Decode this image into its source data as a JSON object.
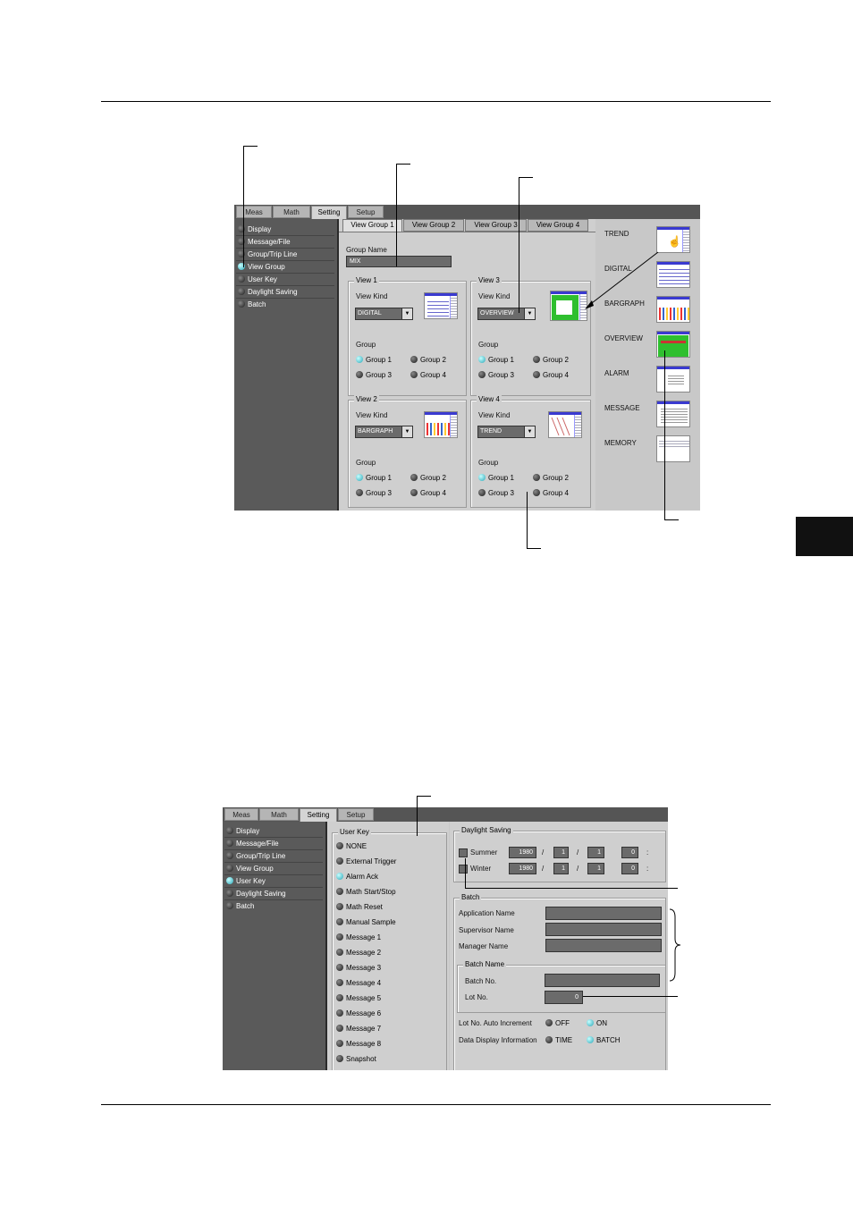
{
  "top_window": {
    "tabs": [
      "Meas",
      "Math",
      "Setting",
      "Setup"
    ],
    "active_tab": "Setting",
    "nav": [
      {
        "label": "Display",
        "active": false
      },
      {
        "label": "Message/File",
        "active": false
      },
      {
        "label": "Group/Trip Line",
        "active": false
      },
      {
        "label": "View Group",
        "active": true
      },
      {
        "label": "User Key",
        "active": false
      },
      {
        "label": "Daylight Saving",
        "active": false
      },
      {
        "label": "Batch",
        "active": false
      }
    ],
    "subtabs": [
      "View Group 1",
      "View Group 2",
      "View Group 3",
      "View Group 4"
    ],
    "group_name_label": "Group Name",
    "group_name_value": "MIX",
    "views": [
      {
        "title": "View 1",
        "kind_label": "View Kind",
        "kind": "DIGITAL",
        "group_label": "Group",
        "groups": [
          "Group 1",
          "Group 2",
          "Group 3",
          "Group 4"
        ],
        "selected": "Group 1"
      },
      {
        "title": "View 3",
        "kind_label": "View Kind",
        "kind": "OVERVIEW",
        "group_label": "Group",
        "groups": [
          "Group 1",
          "Group 2",
          "Group 3",
          "Group 4"
        ],
        "selected": "Group 1"
      },
      {
        "title": "View 2",
        "kind_label": "View Kind",
        "kind": "BARGRAPH",
        "group_label": "Group",
        "groups": [
          "Group 1",
          "Group 2",
          "Group 3",
          "Group 4"
        ],
        "selected": "Group 1"
      },
      {
        "title": "View 4",
        "kind_label": "View Kind",
        "kind": "TREND",
        "group_label": "Group",
        "groups": [
          "Group 1",
          "Group 2",
          "Group 3",
          "Group 4"
        ],
        "selected": "Group 1"
      }
    ],
    "kind_list": [
      "TREND",
      "DIGITAL",
      "BARGRAPH",
      "OVERVIEW",
      "ALARM",
      "MESSAGE",
      "MEMORY"
    ]
  },
  "bottom_window": {
    "tabs": [
      "Meas",
      "Math",
      "Setting",
      "Setup"
    ],
    "active_tab": "Setting",
    "nav": [
      {
        "label": "Display",
        "active": false
      },
      {
        "label": "Message/File",
        "active": false
      },
      {
        "label": "Group/Trip Line",
        "active": false
      },
      {
        "label": "View Group",
        "active": false
      },
      {
        "label": "User Key",
        "active": true
      },
      {
        "label": "Daylight Saving",
        "active": false
      },
      {
        "label": "Batch",
        "active": false
      }
    ],
    "user_key_title": "User Key",
    "user_keys": [
      {
        "label": "NONE",
        "selected": false
      },
      {
        "label": "External Trigger",
        "selected": false
      },
      {
        "label": "Alarm Ack",
        "selected": true
      },
      {
        "label": "Math Start/Stop",
        "selected": false
      },
      {
        "label": "Math Reset",
        "selected": false
      },
      {
        "label": "Manual Sample",
        "selected": false
      },
      {
        "label": "Message 1",
        "selected": false
      },
      {
        "label": "Message 2",
        "selected": false
      },
      {
        "label": "Message 3",
        "selected": false
      },
      {
        "label": "Message 4",
        "selected": false
      },
      {
        "label": "Message 5",
        "selected": false
      },
      {
        "label": "Message 6",
        "selected": false
      },
      {
        "label": "Message 7",
        "selected": false
      },
      {
        "label": "Message 8",
        "selected": false
      },
      {
        "label": "Snapshot",
        "selected": false
      }
    ],
    "daylight": {
      "title": "Daylight Saving",
      "rows": [
        {
          "label": "Summer",
          "year": "1980",
          "month": "1",
          "day": "1",
          "hour": "0"
        },
        {
          "label": "Winter",
          "year": "1980",
          "month": "1",
          "day": "1",
          "hour": "0"
        }
      ],
      "sep": "/",
      "colon": ":"
    },
    "batch": {
      "title": "Batch",
      "application_label": "Application Name",
      "supervisor_label": "Supervisor Name",
      "manager_label": "Manager Name",
      "batch_name_title": "Batch Name",
      "batch_no_label": "Batch No.",
      "lot_no_label": "Lot No.",
      "lot_no_value": "0",
      "auto_inc_label": "Lot No. Auto Increment",
      "auto_inc_off": "OFF",
      "auto_inc_on": "ON",
      "display_info_label": "Data Display Information",
      "display_time": "TIME",
      "display_batch": "BATCH"
    }
  },
  "colors": {
    "nav_bg": "#5a5a5a",
    "panel_bg": "#cfcfcf",
    "led_on": "#2aa7b8",
    "field_bg": "#6b6b6b"
  }
}
